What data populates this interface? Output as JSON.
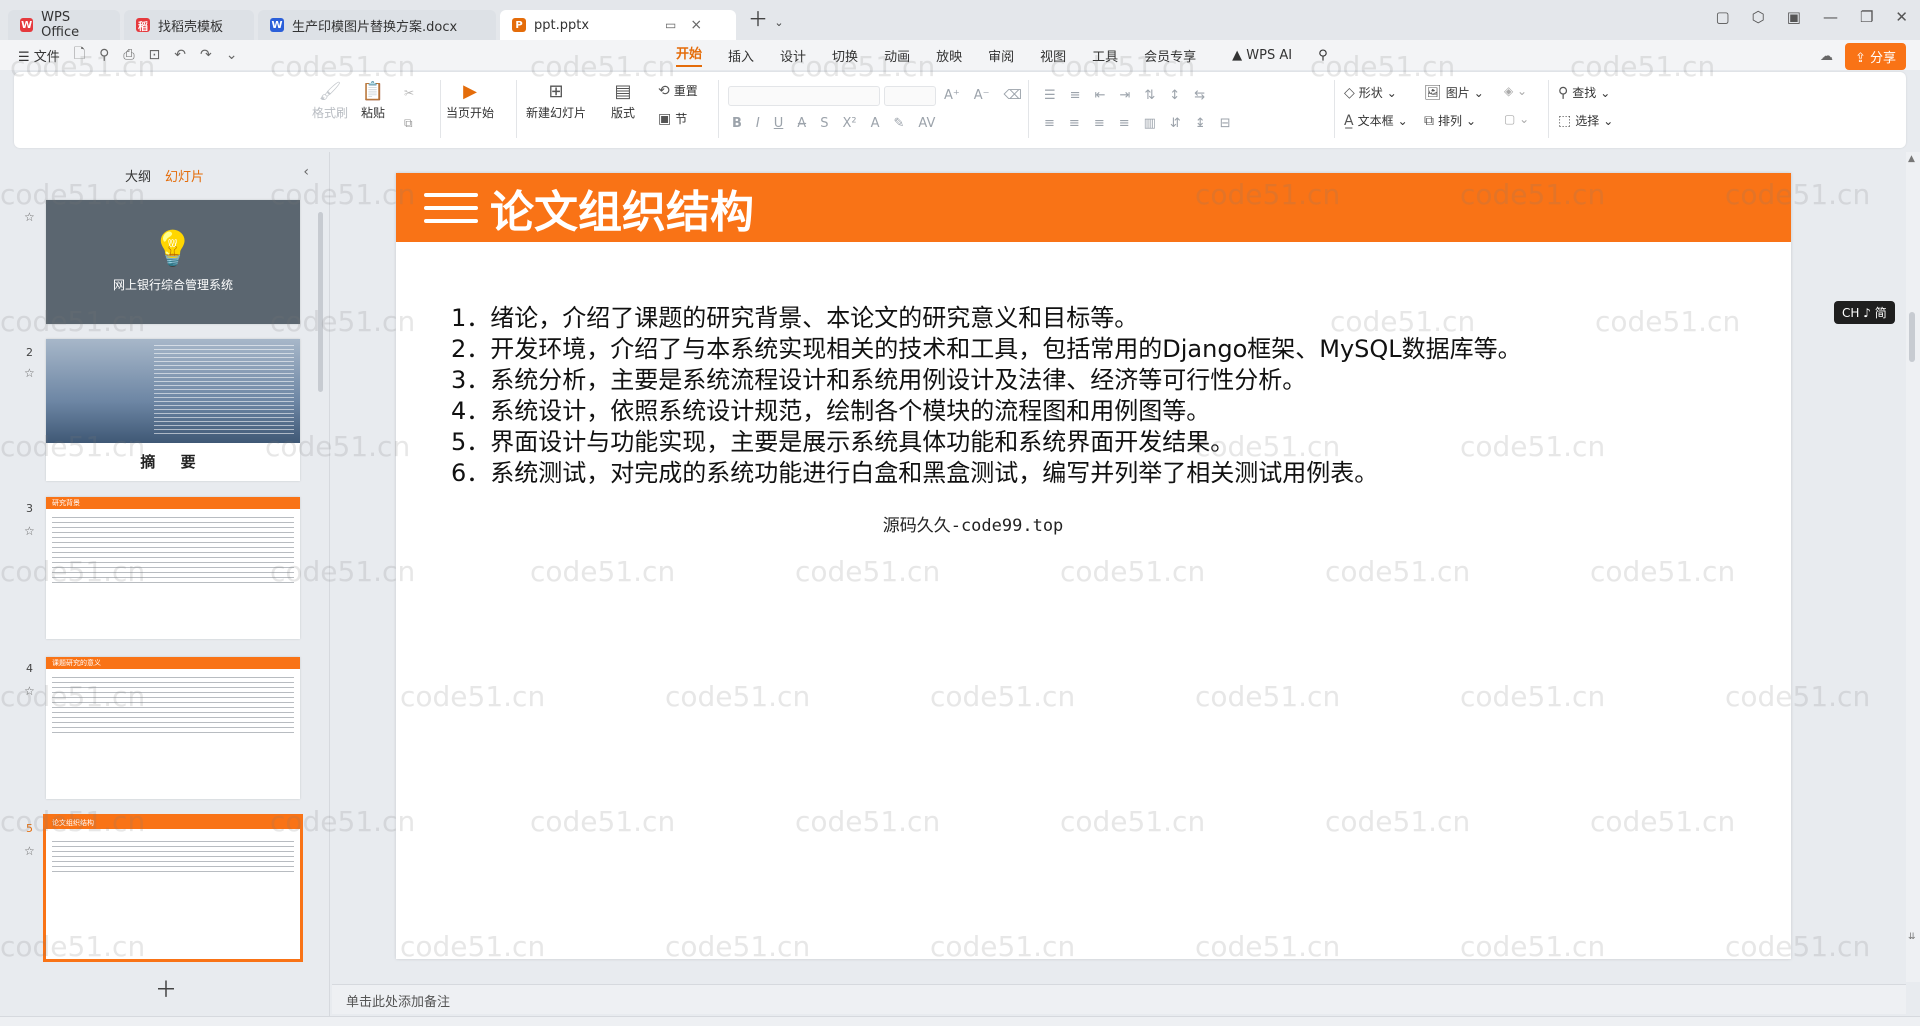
{
  "tabs": [
    {
      "label": "WPS Office",
      "icon": "wps-icon",
      "color": "#e5393d"
    },
    {
      "label": "找稻壳模板",
      "icon": "docer-icon",
      "color": "#e5393d"
    },
    {
      "label": "生产印模图片替换方案.docx",
      "icon": "word-icon",
      "color": "#2b5fd9"
    },
    {
      "label": "ppt.pptx",
      "icon": "ppt-icon",
      "color": "#e46c0a"
    }
  ],
  "menu": {
    "file": "文件",
    "tabs": [
      "开始",
      "插入",
      "设计",
      "切换",
      "动画",
      "放映",
      "审阅",
      "视图",
      "工具",
      "会员专享"
    ],
    "wps_ai": "WPS AI",
    "share": "分享"
  },
  "ribbon": {
    "format_painter": "格式刷",
    "paste": "粘贴",
    "play_from_current": "当页开始",
    "new_slide": "新建幻灯片",
    "layout": "版式",
    "reset": "重置",
    "section": "节",
    "shape": "形状",
    "picture": "图片",
    "textbox": "文本框",
    "arrange": "排列",
    "find": "查找",
    "select": "选择"
  },
  "left_panel": {
    "tab_outline": "大纲",
    "tab_slides": "幻灯片",
    "slides": [
      {
        "num": "",
        "title": "网上银行综合管理系统"
      },
      {
        "num": "2",
        "title": "摘    要"
      },
      {
        "num": "3",
        "title": "研究背景"
      },
      {
        "num": "4",
        "title": "课题研究的意义"
      },
      {
        "num": "5",
        "title": "论文组织结构"
      }
    ]
  },
  "slide": {
    "title": "论文组织结构",
    "items": [
      "1．绪论，介绍了课题的研究背景、本论文的研究意义和目标等。",
      "2．开发环境，介绍了与本系统实现相关的技术和工具，包括常用的Django框架、MySQL数据库等。",
      "3．系统分析，主要是系统流程设计和系统用例设计及法律、经济等可行性分析。",
      "4．系统设计，依照系统设计规范，绘制各个模块的流程图和用例图等。",
      "5．界面设计与功能实现，主要是展示系统具体功能和系统界面开发结果。",
      "6．系统测试，对完成的系统功能进行白盒和黑盒测试，编写并列举了相关测试用例表。"
    ],
    "footer": "源码久久-code99.top"
  },
  "ime": "CH ♪ 简",
  "notes_placeholder": "单击此处添加备注",
  "watermark": "code51.cn",
  "colors": {
    "accent": "#f97316",
    "tab_active_text": "#e46c0a"
  }
}
